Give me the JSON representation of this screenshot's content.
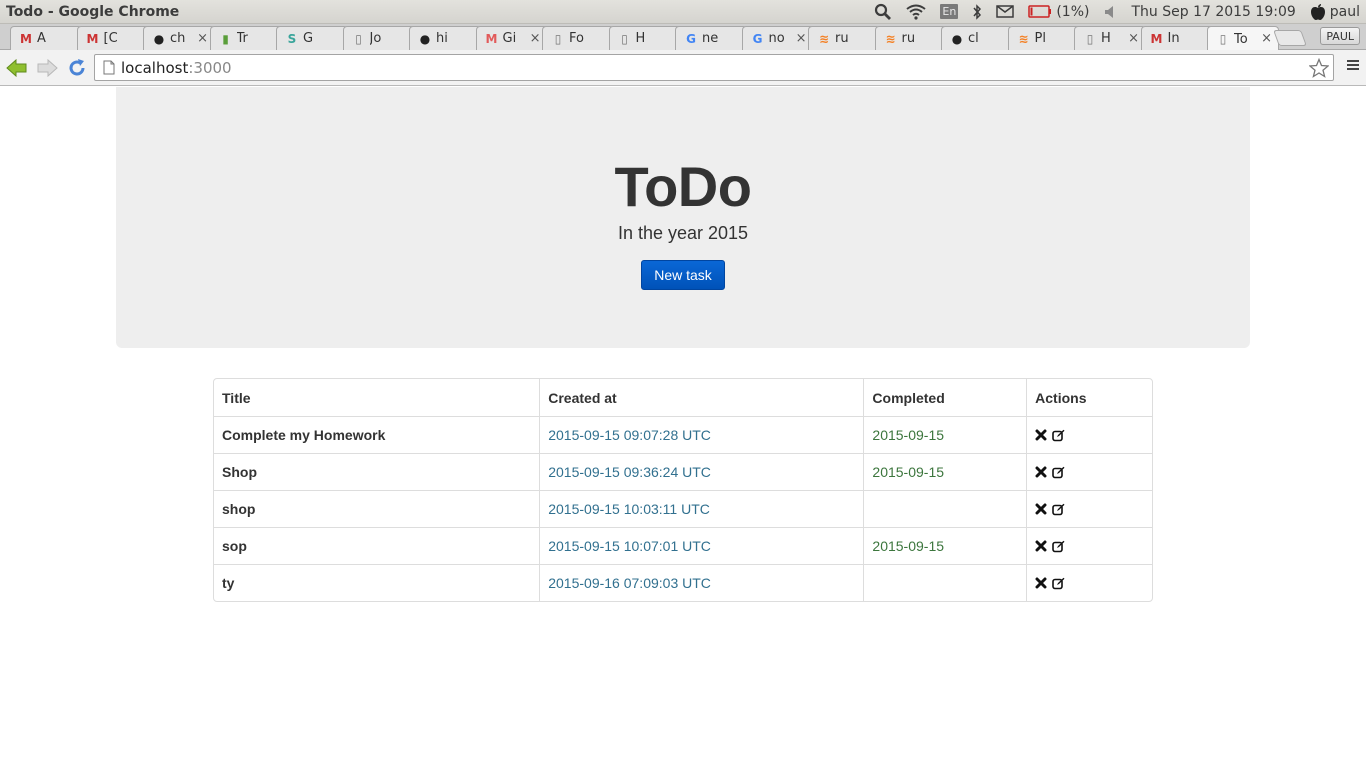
{
  "window": {
    "title": "Todo - Google Chrome"
  },
  "system_tray": {
    "keyboard": "En",
    "battery": "(1%)",
    "datetime": "Thu Sep 17 2015 19:09",
    "user": "paul"
  },
  "tabs": [
    {
      "label": "A",
      "icon": "gmail-icon",
      "color": "#c33"
    },
    {
      "label": "[C",
      "icon": "gmail-icon",
      "color": "#c33"
    },
    {
      "label": "ch",
      "icon": "github-icon",
      "color": "#222"
    },
    {
      "label": "Tr",
      "icon": "trello-icon",
      "color": "#5a9e3a"
    },
    {
      "label": "G",
      "icon": "s-icon",
      "color": "#3aa59b"
    },
    {
      "label": "Jo",
      "icon": "page-icon",
      "color": "#777"
    },
    {
      "label": "hi",
      "icon": "github-icon",
      "color": "#222"
    },
    {
      "label": "Gi",
      "icon": "m-icon",
      "color": "#e25a5a"
    },
    {
      "label": "Fo",
      "icon": "page-icon",
      "color": "#777"
    },
    {
      "label": "H",
      "icon": "page-icon",
      "color": "#777"
    },
    {
      "label": "ne",
      "icon": "google-icon",
      "color": "#4285f4"
    },
    {
      "label": "no",
      "icon": "google-icon",
      "color": "#4285f4"
    },
    {
      "label": "ru",
      "icon": "stackoverflow-icon",
      "color": "#f48024"
    },
    {
      "label": "ru",
      "icon": "stackoverflow-icon",
      "color": "#f48024"
    },
    {
      "label": "cl",
      "icon": "github-icon",
      "color": "#222"
    },
    {
      "label": "Pl",
      "icon": "stackoverflow-icon",
      "color": "#f48024"
    },
    {
      "label": "H",
      "icon": "page-icon",
      "color": "#777"
    },
    {
      "label": "In",
      "icon": "gmail-icon",
      "color": "#c33"
    },
    {
      "label": "To",
      "icon": "page-icon",
      "color": "#777"
    }
  ],
  "profile_button": "PAUL",
  "address": {
    "host": "localhost",
    "port": ":3000"
  },
  "page": {
    "heading": "ToDo",
    "subheading": "In the year 2015",
    "new_task_label": "New task"
  },
  "table": {
    "headers": [
      "Title",
      "Created at",
      "Completed",
      "Actions"
    ],
    "rows": [
      {
        "title": "Complete my Homework",
        "created": "2015-09-15 09:07:28 UTC",
        "completed": "2015-09-15"
      },
      {
        "title": "Shop",
        "created": "2015-09-15 09:36:24 UTC",
        "completed": "2015-09-15"
      },
      {
        "title": "shop",
        "created": "2015-09-15 10:03:11 UTC",
        "completed": ""
      },
      {
        "title": "sop",
        "created": "2015-09-15 10:07:01 UTC",
        "completed": "2015-09-15"
      },
      {
        "title": "ty",
        "created": "2015-09-16 07:09:03 UTC",
        "completed": ""
      }
    ]
  },
  "colors": {
    "accent": "#0a67d6",
    "created_text": "#31708f",
    "completed_text": "#3c763d",
    "jumbotron_bg": "#eeeeee"
  }
}
